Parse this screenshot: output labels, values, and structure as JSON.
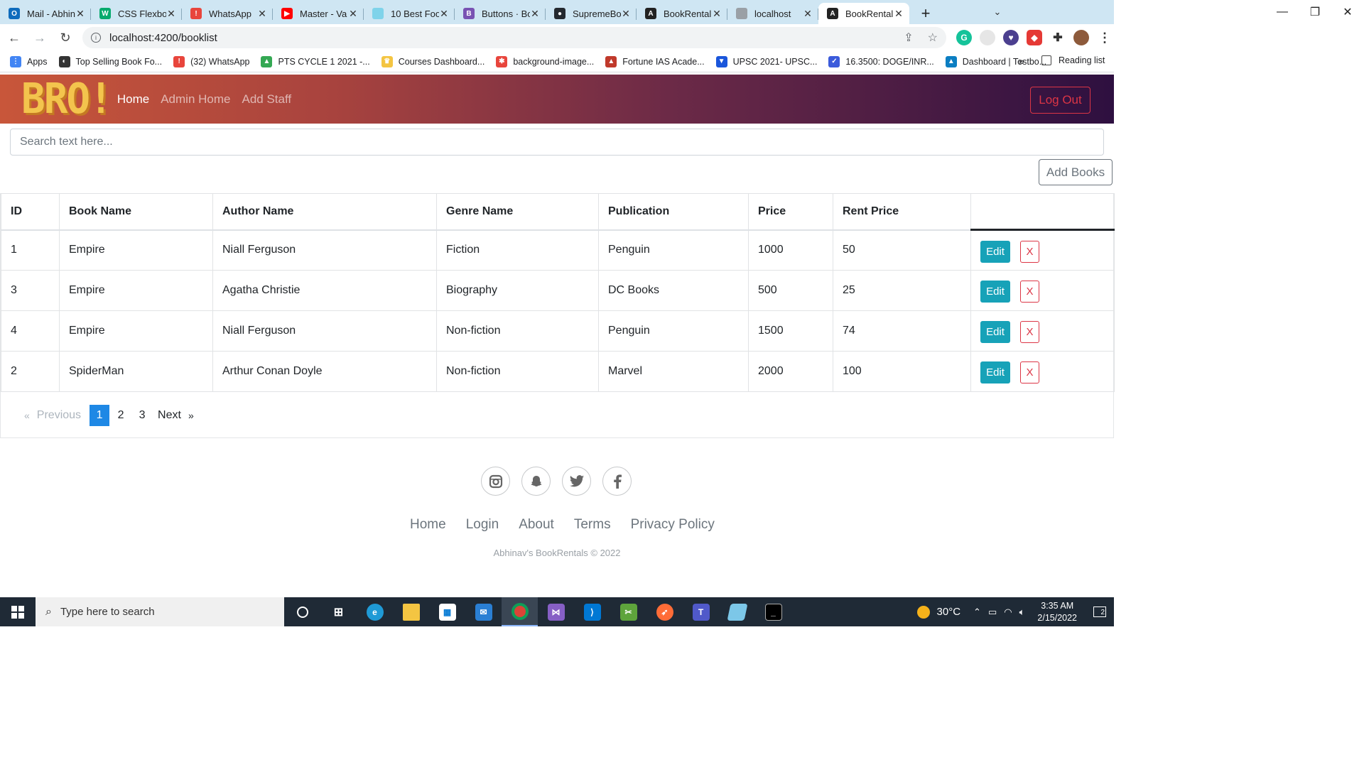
{
  "browser": {
    "tabs": [
      {
        "title": "Mail - Abhinav",
        "icon": "outlook-icon",
        "color": "#0f6cbd",
        "glyph": "O"
      },
      {
        "title": "CSS Flexbox",
        "icon": "w3-icon",
        "color": "#04aa6d",
        "glyph": "W"
      },
      {
        "title": "WhatsApp",
        "icon": "whatsapp-icon",
        "color": "#e8453c",
        "glyph": "!"
      },
      {
        "title": "Master - Va",
        "icon": "youtube-icon",
        "color": "#ff0000",
        "glyph": "▶"
      },
      {
        "title": "10 Best Foo",
        "icon": "image-icon",
        "color": "#7fd3ea",
        "glyph": ""
      },
      {
        "title": "Buttons · Bo",
        "icon": "bootstrap-icon",
        "color": "#7952b3",
        "glyph": "B"
      },
      {
        "title": "SupremeBo",
        "icon": "github-icon",
        "color": "#24292f",
        "glyph": "●"
      },
      {
        "title": "BookRental",
        "icon": "angular-icon",
        "color": "#222222",
        "glyph": "A"
      },
      {
        "title": "localhost",
        "icon": "globe-icon",
        "color": "#9aa0a6",
        "glyph": ""
      },
      {
        "title": "BookRental",
        "icon": "angular-icon",
        "color": "#222222",
        "glyph": "A",
        "active": true
      }
    ],
    "url": "localhost:4200/booklist",
    "bookmarks": [
      {
        "label": "Apps",
        "color": "#4285f4",
        "glyph": "⋮"
      },
      {
        "label": "Top Selling Book Fo...",
        "color": "#333333",
        "glyph": "◐"
      },
      {
        "label": "(32) WhatsApp",
        "color": "#e8453c",
        "glyph": "!"
      },
      {
        "label": "PTS CYCLE 1 2021 -...",
        "color": "#34a853",
        "glyph": "▲"
      },
      {
        "label": "Courses Dashboard...",
        "color": "#f4c542",
        "glyph": "♛"
      },
      {
        "label": "background-image...",
        "color": "#e8453c",
        "glyph": "✱"
      },
      {
        "label": "Fortune IAS Acade...",
        "color": "#c0392b",
        "glyph": "▲"
      },
      {
        "label": "UPSC 2021- UPSC...",
        "color": "#1a56db",
        "glyph": "▼"
      },
      {
        "label": "16.3500: DOGE/INR...",
        "color": "#3b5bdb",
        "glyph": "✓"
      },
      {
        "label": "Dashboard | Testbo...",
        "color": "#0b7ec2",
        "glyph": "▲"
      }
    ],
    "bookmarks_more": "»",
    "reading_list": "Reading list"
  },
  "app": {
    "logo": "BRO!",
    "nav": {
      "home": "Home",
      "admin_home": "Admin Home",
      "add_staff": "Add Staff"
    },
    "logout": "Log Out",
    "search_placeholder": "Search text here...",
    "add_books": "Add Books",
    "table": {
      "headers": [
        "ID",
        "Book Name",
        "Author Name",
        "Genre Name",
        "Publication",
        "Price",
        "Rent Price"
      ],
      "rows": [
        [
          "1",
          "Empire",
          "Niall Ferguson",
          "Fiction",
          "Penguin",
          "1000",
          "50"
        ],
        [
          "3",
          "Empire",
          "Agatha Christie",
          "Biography",
          "DC Books",
          "500",
          "25"
        ],
        [
          "4",
          "Empire",
          "Niall Ferguson",
          "Non-fiction",
          "Penguin",
          "1500",
          "74"
        ],
        [
          "2",
          "SpiderMan",
          "Arthur Conan Doyle",
          "Non-fiction",
          "Marvel",
          "2000",
          "100"
        ]
      ],
      "edit_label": "Edit",
      "delete_label": "X"
    },
    "pagination": {
      "prev_arrow": "«",
      "prev": "Previous",
      "pages": [
        "1",
        "2",
        "3"
      ],
      "current": "1",
      "next": "Next",
      "next_arrow": "»"
    },
    "footer": {
      "social": [
        "instagram-icon",
        "snapchat-icon",
        "twitter-icon",
        "facebook-icon"
      ],
      "links": [
        "Home",
        "Login",
        "About",
        "Terms",
        "Privacy Policy"
      ],
      "copyright": "Abhinav's BookRentals © 2022"
    }
  },
  "taskbar": {
    "search_placeholder": "Type here to search",
    "temperature": "30°C",
    "time": "3:35 AM",
    "date": "2/15/2022",
    "notifications": "2"
  }
}
